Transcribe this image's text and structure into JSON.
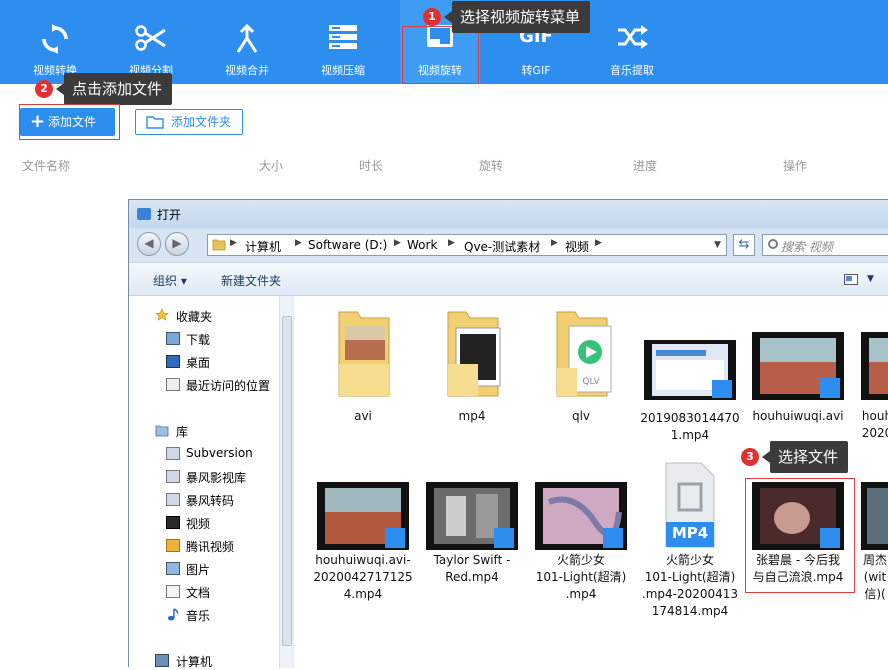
{
  "toolbar": {
    "items": [
      {
        "label": "视频转换",
        "icon": "convert-icon"
      },
      {
        "label": "视频分割",
        "icon": "scissors-icon"
      },
      {
        "label": "视频合并",
        "icon": "merge-icon"
      },
      {
        "label": "视频压缩",
        "icon": "compress-icon"
      },
      {
        "label": "视频旋转",
        "icon": "rotate-icon"
      },
      {
        "label": "转GIF",
        "icon": "gif-icon",
        "icon_text": "GIF"
      },
      {
        "label": "音乐提取",
        "icon": "shuffle-icon"
      }
    ]
  },
  "callouts": {
    "c1": {
      "num": "1",
      "text": "选择视频旋转菜单"
    },
    "c2": {
      "num": "2",
      "text": "点击添加文件"
    },
    "c3": {
      "num": "3",
      "text": "选择文件"
    }
  },
  "main": {
    "add_file": "添加文件",
    "add_folder": "添加文件夹",
    "columns": [
      "文件名称",
      "大小",
      "时长",
      "旋转",
      "进度",
      "操作"
    ]
  },
  "dialog": {
    "title": "打开",
    "breadcrumb": [
      "计算机",
      "Software (D:)",
      "Work",
      "Qve-测试素材",
      "视频"
    ],
    "search_placeholder": "搜索 视频",
    "commands": {
      "organize": "组织 ▾",
      "new_folder": "新建文件夹"
    },
    "nav": {
      "favorites": "收藏夹",
      "fav_items": [
        "下载",
        "桌面",
        "最近访问的位置"
      ],
      "library": "库",
      "lib_items": [
        "Subversion",
        "暴风影视库",
        "暴风转码",
        "视频",
        "腾讯视频",
        "图片",
        "文档",
        "音乐"
      ],
      "computer": "计算机"
    },
    "files": [
      {
        "name": [
          "avi"
        ],
        "kind": "folder-video"
      },
      {
        "name": [
          "mp4"
        ],
        "kind": "folder-video"
      },
      {
        "name": [
          "qlv"
        ],
        "kind": "folder-qlv"
      },
      {
        "name": [
          "2019083014470",
          "1.mp4"
        ],
        "kind": "video"
      },
      {
        "name": [
          "houhuiwuqi.avi"
        ],
        "kind": "video"
      },
      {
        "name": [
          "houh",
          "2020"
        ],
        "kind": "video"
      },
      {
        "name": [
          "houhuiwuqi.avi-",
          "2020042717125",
          "4.mp4"
        ],
        "kind": "video"
      },
      {
        "name": [
          "Taylor Swift -",
          "Red.mp4"
        ],
        "kind": "video"
      },
      {
        "name": [
          "火箭少女",
          "101-Light(超清)",
          ".mp4"
        ],
        "kind": "video"
      },
      {
        "name": [
          "火箭少女",
          "101-Light(超清)",
          ".mp4-20200413",
          "174814.mp4"
        ],
        "kind": "mp4-doc",
        "badge": "MP4"
      },
      {
        "name": [
          "张碧晨 - 今后我",
          "与自己流浪.mp4"
        ],
        "kind": "video"
      },
      {
        "name": [
          "周杰",
          "(wit",
          "信)("
        ],
        "kind": "video"
      }
    ]
  },
  "colors": {
    "primary": "#2e8ef0",
    "highlight": "#e23b3b",
    "callout": "#3b3b3b"
  }
}
